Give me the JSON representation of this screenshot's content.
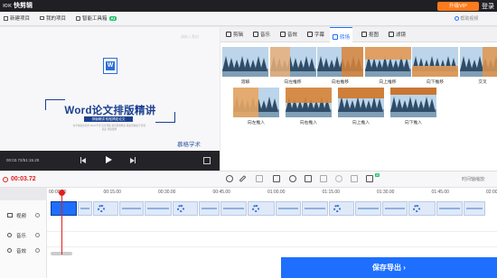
{
  "app": {
    "title": "快剪辑",
    "vip_label": "升级VIP",
    "login_label": "登录"
  },
  "toolbar": {
    "new_project": "新建项目",
    "my_projects": "我的项目",
    "smart_tools": "智能工具箱",
    "ai_badge": "AI",
    "help": "帮助视频"
  },
  "preview": {
    "watermark": "请拖入素材",
    "doc_icon_letter": "W",
    "title": "Word论文排版精讲",
    "subtitle": "排版精讲 轻松搞定论文",
    "small_text": "在学校提交论文 Word 毕业 论文排版 格式要求繁多 快速掌握技巧 轻松搞定 排版要求",
    "brand": "慕格学术",
    "time": "00:03.72/51:15.20"
  },
  "tabs": [
    "剪辑",
    "音乐",
    "音效",
    "字幕",
    "转场",
    "抠图",
    "滤镜"
  ],
  "active_tab": 4,
  "transitions": [
    {
      "label": "溶解"
    },
    {
      "label": "向左推移"
    },
    {
      "label": "向右推移"
    },
    {
      "label": "向上推移"
    },
    {
      "label": "向下推移"
    },
    {
      "label": "交叉"
    },
    {
      "label": "向左推入"
    },
    {
      "label": "向右推入"
    },
    {
      "label": "向上推入"
    },
    {
      "label": "向下推入"
    }
  ],
  "timeline": {
    "current_time": "00:03.72",
    "zoom_label": "时间轴缩放:",
    "ticks": [
      "00:00.00",
      "00:15.00",
      "00:30.00",
      "00:45.00",
      "01:00.00",
      "01:15.00",
      "01:30.00",
      "01:45.00",
      "02:00"
    ],
    "tracks": [
      "视频",
      "音乐",
      "音效"
    ]
  },
  "export_label": "保存导出"
}
